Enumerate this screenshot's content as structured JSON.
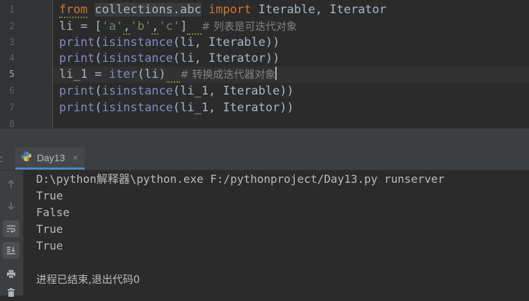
{
  "editor": {
    "line_numbers": [
      "1",
      "2",
      "3",
      "4",
      "5",
      "6",
      "7",
      "8"
    ],
    "active_line": 5,
    "tokens": {
      "l1_from": "from",
      "l1_module": "collections.abc",
      "l1_import": "import",
      "l1_rest": " Iterable, Iterator",
      "l2_a": "li = [",
      "l2_s1": "'a'",
      "l2_c1": ",",
      "l2_s2": "'b'",
      "l2_c2": ",",
      "l2_s3": "'c'",
      "l2_end": "]",
      "l2_comment": "# 列表是可迭代对象",
      "l3_print": "print",
      "l3_open": "(",
      "l3_isinstance": "isinstance",
      "l3_args": "(li, Iterable))",
      "l4_print": "print",
      "l4_open": "(",
      "l4_isinstance": "isinstance",
      "l4_args": "(li, Iterator))",
      "l5_a": "li_1 = ",
      "l5_iter": "iter",
      "l5_args": "(li)",
      "l5_comment": "# 转换成迭代器对象",
      "l6_print": "print",
      "l6_open": "(",
      "l6_isinstance": "isinstance",
      "l6_args": "(li_1, Iterable))",
      "l7_print": "print",
      "l7_open": "(",
      "l7_isinstance": "isinstance",
      "l7_args": "(li_1, Iterator))"
    }
  },
  "run_panel": {
    "colon": ":",
    "tab_label": "Day13",
    "close_glyph": "×",
    "output": [
      "D:\\python解释器\\python.exe F:/pythonproject/Day13.py runserver",
      "True",
      "False",
      "True",
      "True",
      "",
      "进程已结束,退出代码0"
    ]
  },
  "icons": {
    "tab_icon": "python-file-icon",
    "toolbar": [
      "up-arrow-icon",
      "down-arrow-icon",
      "soft-wrap-icon",
      "scroll-to-end-icon",
      "print-icon",
      "trash-icon"
    ]
  },
  "colors": {
    "editor_bg": "#2b2b2b",
    "keyword": "#cc7832",
    "string": "#6a8759",
    "builtin": "#8888c6",
    "comment": "#808080",
    "text": "#a9b7c6",
    "tab_underline": "#4a88c7"
  }
}
